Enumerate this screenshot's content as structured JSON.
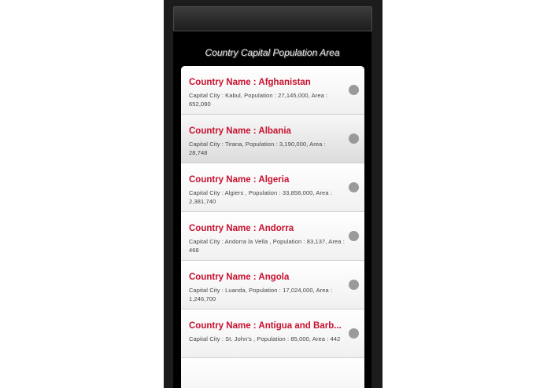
{
  "header": {
    "title": "Country Capital Population Area"
  },
  "countries": [
    {
      "title": "Country Name : Afghanistan",
      "desc": "Capital City : Kabul, Population : 27,145,000, Area : 652,090"
    },
    {
      "title": "Country Name : Albania",
      "desc": "Capital City : Tirana, Population : 3,190,000, Area : 28,748"
    },
    {
      "title": "Country Name : Algeria",
      "desc": "Capital City : Algiers , Population : 33,858,000, Area : 2,381,740"
    },
    {
      "title": "Country Name : Andorra",
      "desc": "Capital City : Andorra la Vella , Population : 83,137, Area : 468"
    },
    {
      "title": "Country Name : Angola",
      "desc": "Capital City : Luanda, Population : 17,024,000, Area : 1,246,700"
    },
    {
      "title": "Country Name : Antigua and Barb...",
      "desc": "Capital City : St. John's , Population : 85,000, Area : 442"
    }
  ],
  "colors": {
    "title_red": "#c8102e",
    "list_bg": "#f2f2f2",
    "chevron": "#9a9a9a"
  },
  "icons": {
    "list_item_arrow": "chevron-circle-icon"
  }
}
